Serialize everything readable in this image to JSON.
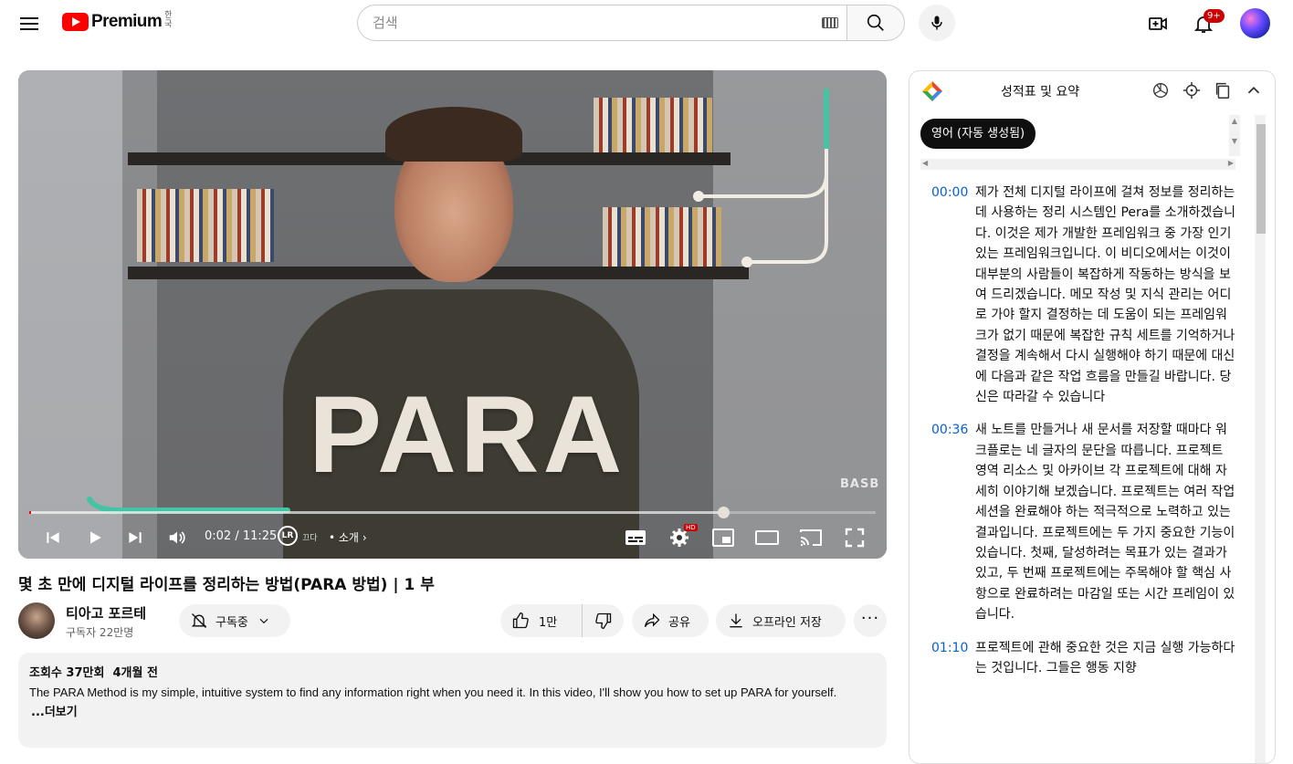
{
  "header": {
    "brand": "Premium",
    "region": "한국",
    "search_placeholder": "검색",
    "notification_count": "9+"
  },
  "player": {
    "overlay_text": "PARA",
    "watermark": "BASB",
    "time": "0:02 / 11:25",
    "chapter": "• 소개",
    "chapter_logo": "LR",
    "chapter_prefix": "끄다",
    "progress_played": 0.002,
    "progress_buffered": 0.82
  },
  "video": {
    "title": "몇 초 만에 디지털 라이프를 정리하는 방법(PARA 방법) | 1 부",
    "channel_name": "티아고 포르테",
    "subscribers": "구독자 22만명",
    "subscribe_label": "구독중",
    "like_count": "1만",
    "share_label": "공유",
    "download_label": "오프라인 저장",
    "views": "조회수 37만회",
    "age": "4개월 전",
    "description": "The PARA Method is my simple, intuitive system to find any information right when you need it. In this video, I'll show you how to set up PARA for yourself.",
    "more_label": "...더보기"
  },
  "panel": {
    "title": "성적표 및 요약",
    "language_chip": "영어 (자동 생성됨)",
    "entries": [
      {
        "ts": "00:00",
        "text": "제가 전체 디지털 라이프에 걸쳐 정보를 정리하는 데 사용하는 정리 시스템인 Pera를 소개하겠습니다. 이것은 제가 개발한 프레임워크 중 가장 인기 있는 프레임워크입니다. 이 비디오에서는 이것이 대부분의 사람들이 복잡하게 작동하는 방식을 보여 드리겠습니다. 메모 작성 및 지식 관리는 어디로 가야 할지 결정하는 데 도움이 되는 프레임워크가 없기 때문에 복잡한 규칙 세트를 기억하거나 결정을 계속해서 다시 실행해야 하기 때문에 대신에 다음과 같은 작업 흐름을 만들길 바랍니다. 당신은 따라갈 수 있습니다"
      },
      {
        "ts": "00:36",
        "text": "새 노트를 만들거나 새 문서를 저장할 때마다 워크플로는 네 글자의 문단을 따릅니다. 프로젝트 영역 리소스 및 아카이브 각 프로젝트에 대해 자세히 이야기해 보겠습니다. 프로젝트는 여러 작업 세션을 완료해야 하는 적극적으로 노력하고 있는 결과입니다. 프로젝트에는 두 가지 중요한 기능이 있습니다. 첫째, 달성하려는 목표가 있는 결과가 있고, 두 번째 프로젝트에는 주목해야 할 핵심 사항으로 완료하려는 마감일 또는 시간 프레임이 있습니다."
      },
      {
        "ts": "01:10",
        "text": "프로젝트에 관해 중요한 것은 지금 실행 가능하다는 것입니다. 그들은 행동 지향"
      }
    ]
  }
}
